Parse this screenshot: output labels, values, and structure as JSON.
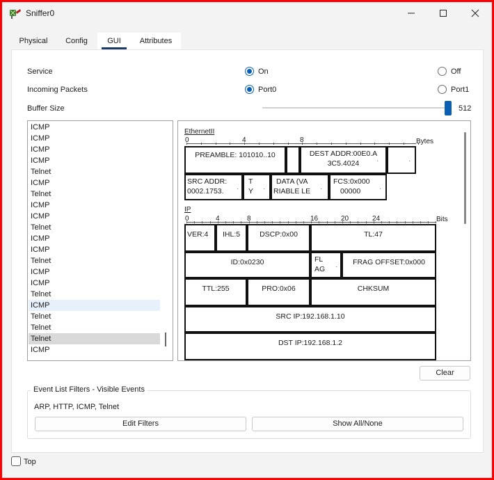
{
  "window": {
    "title": "Sniffer0",
    "minimize_label": "minimize",
    "maximize_label": "maximize",
    "close_label": "close"
  },
  "tabs": [
    "Physical",
    "Config",
    "GUI",
    "Attributes"
  ],
  "settings": {
    "service_label": "Service",
    "service_on": "On",
    "service_off": "Off",
    "service_selected": "On",
    "incoming_label": "Incoming Packets",
    "incoming_port0": "Port0",
    "incoming_port1": "Port1",
    "incoming_selected": "Port0",
    "buffer_label": "Buffer Size",
    "buffer_value": "512",
    "buffer_slider_fraction": 1.0
  },
  "events": [
    "ICMP",
    "ICMP",
    "ICMP",
    "ICMP",
    "Telnet",
    "ICMP",
    "Telnet",
    "ICMP",
    "ICMP",
    "Telnet",
    "ICMP",
    "ICMP",
    "Telnet",
    "ICMP",
    "ICMP",
    "Telnet",
    "ICMP",
    "Telnet",
    "Telnet",
    "Telnet",
    "ICMP"
  ],
  "events_highlighted_index": 16,
  "events_selected_index": 19,
  "pdu": {
    "ethernet": {
      "title": "EthernetII",
      "ruler_labels": [
        "0",
        "4",
        "8"
      ],
      "unit": "Bytes",
      "preamble": "PREAMBLE: 101010..10",
      "dest_addr_l1": "DEST ADDR:00E0.A",
      "dest_addr_l2": "3C5.4024",
      "src_addr_l1": "SRC ADDR:",
      "src_addr_l2": "0002.1753.",
      "type_l1": "T",
      "type_l2": "Y",
      "data_l1": "DATA (VA",
      "data_l2": "RIABLE LE",
      "fcs_l1": "FCS:0x000",
      "fcs_l2": "00000"
    },
    "ip": {
      "title": "IP",
      "ruler_labels": [
        "0",
        "4",
        "8",
        "16",
        "20",
        "24"
      ],
      "unit": "Bits",
      "ver": "VER:4",
      "ihl": "IHL:5",
      "dscp": "DSCP:0x00",
      "tl": "TL:47",
      "id": "ID:0x0230",
      "flag_l1": "FL",
      "flag_l2": "AG",
      "frag": "FRAG OFFSET:0x000",
      "ttl": "TTL:255",
      "pro": "PRO:0x06",
      "chksum": "CHKSUM",
      "src_ip": "SRC IP:192.168.1.10",
      "dst_ip": "DST IP:192.168.1.2"
    },
    "ellipsis": "."
  },
  "clear_button": "Clear",
  "filters": {
    "legend": "Event List Filters - Visible Events",
    "visible_events": "ARP, HTTP, ICMP, Telnet",
    "edit_button": "Edit Filters",
    "show_all_button": "Show All/None"
  },
  "top_checkbox": {
    "label": "Top",
    "checked": false
  },
  "colors": {
    "accent": "#0a5fb4",
    "frame": "#ff0000",
    "tab_underline": "#1b3a66"
  }
}
